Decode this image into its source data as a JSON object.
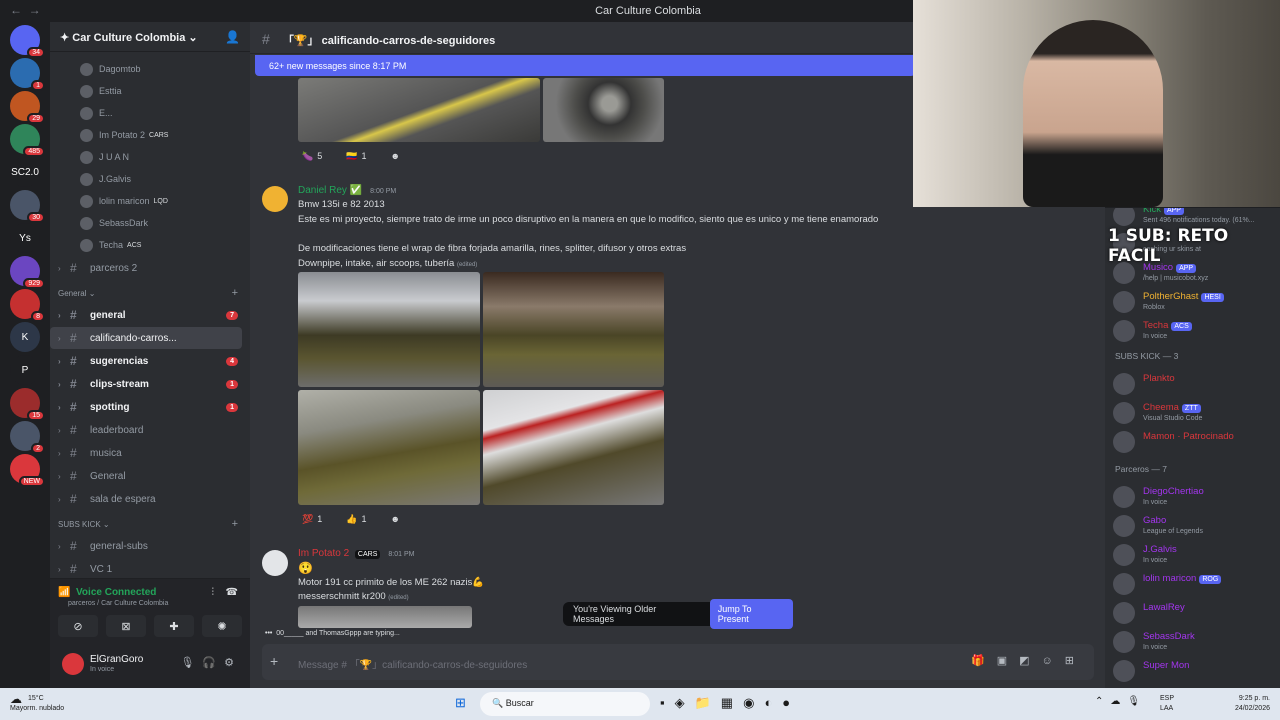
{
  "window": {
    "title": "Car Culture Colombia"
  },
  "server": {
    "name": "Car Culture Colombia"
  },
  "guild_badges": [
    "34",
    "1",
    "29",
    "485",
    "SC2.0",
    "30",
    "Ys",
    "929",
    "8",
    "K",
    "P",
    "15",
    "2",
    "NEW"
  ],
  "voice_members": [
    {
      "name": "Dagomtob",
      "tag": ""
    },
    {
      "name": "Esttia",
      "tag": ""
    },
    {
      "name": "E...",
      "tag": ""
    },
    {
      "name": "Im Potato 2",
      "tag": "CARS"
    },
    {
      "name": "J U A N",
      "tag": ""
    },
    {
      "name": "J.Galvis",
      "tag": ""
    },
    {
      "name": "lolin maricon",
      "tag": "LQD"
    },
    {
      "name": "SebassDark",
      "tag": ""
    },
    {
      "name": "Techa",
      "tag": "ACS"
    }
  ],
  "channels_top": [
    {
      "name": "parceros 2"
    }
  ],
  "category_general": "General",
  "channels": [
    {
      "name": "general",
      "badge": "7"
    },
    {
      "name": "calificando-carros...",
      "badge": ""
    },
    {
      "name": "sugerencias",
      "badge": "4"
    },
    {
      "name": "clips-stream",
      "badge": "1"
    },
    {
      "name": "spotting",
      "badge": "1"
    },
    {
      "name": "leaderboard",
      "badge": ""
    },
    {
      "name": "musica",
      "badge": ""
    },
    {
      "name": "General",
      "badge": ""
    },
    {
      "name": "sala de espera",
      "badge": ""
    }
  ],
  "category_subs": "SUBS KICK",
  "channels_subs": [
    {
      "name": "general-subs"
    },
    {
      "name": "VC 1"
    }
  ],
  "voice_panel": {
    "status": "Voice Connected",
    "location": "parceros / Car Culture Colombia"
  },
  "user": {
    "name": "ElGranGoro",
    "status": "In voice"
  },
  "channel_header": "calificando-carros-de-seguidores",
  "new_messages": "62+ new messages since 8:17 PM",
  "msg1_reactions": [
    {
      "emoji": "🍆",
      "count": "5"
    },
    {
      "emoji": "🇨🇴",
      "count": "1"
    }
  ],
  "msg2": {
    "author": "Daniel Rey",
    "time": "8:00 PM",
    "lines": [
      "Bmw 135i e 82 2013",
      "Este es mi proyecto, siempre trato de irme un poco disruptivo en la manera en que lo modifico, siento que es unico y me tiene enamorado",
      "De modificaciones tiene el wrap de fibra forjada amarilla, rines, splitter, difusor y otros extras",
      "Downpipe, intake, air scoops, tubería"
    ],
    "edited": "(edited)",
    "reactions": [
      {
        "emoji": "💯",
        "count": "1"
      },
      {
        "emoji": "👍",
        "count": "1"
      }
    ]
  },
  "msg3": {
    "author": "Im Potato 2",
    "tag": "CARS",
    "time": "8:01 PM",
    "emoji": "😲",
    "lines": [
      "Motor 191 cc primito de los ME 262 nazis💪",
      "messerschmitt kr200"
    ],
    "edited": "(edited)"
  },
  "older_banner": {
    "text": "You're Viewing Older Messages",
    "button": "Jump To Present"
  },
  "typing": "00_____ and ThomasGppp are typing...",
  "composer_placeholder": "Message # 「🏆」calificando-carros-de-seguidores",
  "members_list": [
    {
      "name": "Kick",
      "tag": "APP",
      "status": "Sent 496 notifications today. (61%...",
      "color": "#23a55a"
    },
    {
      "name": "",
      "tag": "",
      "status": "cashing ur skins at",
      "color": "#dbdee1"
    },
    {
      "name": "Musico",
      "tag": "APP",
      "status": "/help | musicobot.xyz",
      "color": "#a335ee"
    },
    {
      "name": "PoltherGhast",
      "tag": "HESI",
      "status": "Roblox",
      "color": "#f0b232"
    },
    {
      "name": "Techa",
      "tag": "ACS",
      "status": "In voice",
      "color": "#da373c"
    }
  ],
  "subs_header": "SUBS KICK — 3",
  "subs_members": [
    {
      "name": "Plankto",
      "tag": "",
      "status": "",
      "color": "#da373c"
    },
    {
      "name": "Cheema",
      "tag": "ZTT",
      "status": "Visual Studio Code",
      "color": "#da373c"
    },
    {
      "name": "Mamon · Patrocinado",
      "tag": "",
      "status": "",
      "color": "#da373c"
    }
  ],
  "parceros_header": "Parceros — 7",
  "parceros": [
    {
      "name": "DiegoChertiao",
      "tag": "",
      "status": "In voice",
      "color": "#a335ee"
    },
    {
      "name": "Gabo",
      "tag": "",
      "status": "League of Legends",
      "color": "#a335ee"
    },
    {
      "name": "J.Galvis",
      "tag": "",
      "status": "In voice",
      "color": "#a335ee"
    },
    {
      "name": "lolin maricon",
      "tag": "ROG",
      "status": "",
      "color": "#a335ee"
    },
    {
      "name": "LawalRey",
      "tag": "",
      "status": "",
      "color": "#a335ee"
    },
    {
      "name": "SebassDark",
      "tag": "",
      "status": "In voice",
      "color": "#a335ee"
    },
    {
      "name": "Super Mon",
      "tag": "",
      "status": "",
      "color": "#a335ee"
    }
  ],
  "stream_overlay": "1 SUB: RETO FACIL",
  "taskbar": {
    "temp": "15°C",
    "weather": "Mayorm. nublado",
    "search": "Buscar",
    "lang1": "ESP",
    "lang2": "LAA",
    "time": "9:25 p. m.",
    "date": "24/02/2026"
  },
  "colors": {
    "accent": "#5865f2",
    "bg": "#313338",
    "sidebar": "#2b2d31",
    "online": "#23a55a",
    "danger": "#da373c"
  }
}
